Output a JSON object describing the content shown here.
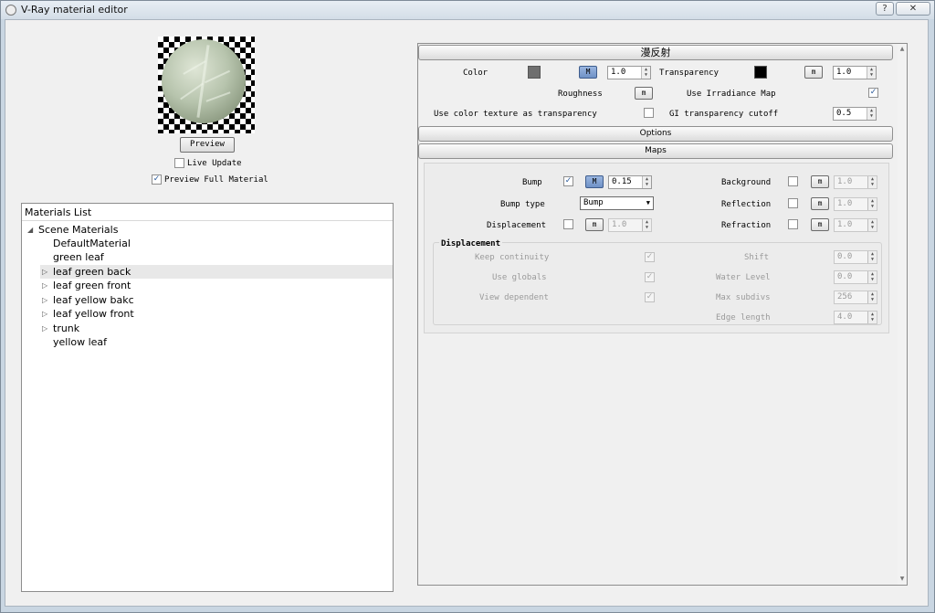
{
  "window": {
    "title": "V-Ray material editor",
    "help_label": "?",
    "close_label": "✕"
  },
  "preview": {
    "button_label": "Preview",
    "live_update_label": "Live Update",
    "live_update_checked": false,
    "preview_full_label": "Preview Full Material",
    "preview_full_checked": true
  },
  "materials": {
    "header": "Materials List",
    "root_label": "Scene Materials",
    "items": [
      {
        "label": "DefaultMaterial",
        "expandable": false,
        "selected": false
      },
      {
        "label": "green leaf",
        "expandable": false,
        "selected": false
      },
      {
        "label": "leaf green back",
        "expandable": true,
        "selected": true
      },
      {
        "label": "leaf green front",
        "expandable": true,
        "selected": false
      },
      {
        "label": "leaf yellow bakc",
        "expandable": true,
        "selected": false
      },
      {
        "label": "leaf yellow front",
        "expandable": true,
        "selected": false
      },
      {
        "label": "trunk",
        "expandable": true,
        "selected": false
      },
      {
        "label": "yellow leaf",
        "expandable": false,
        "selected": false
      }
    ]
  },
  "diffuse": {
    "header": "漫反射",
    "color_label": "Color",
    "color_swatch": "#6f6f6f",
    "color_map_label": "M",
    "color_value": "1.0",
    "transparency_label": "Transparency",
    "transparency_swatch": "#000000",
    "transparency_map_label": "m",
    "transparency_value": "1.0",
    "roughness_label": "Roughness",
    "roughness_map_label": "m",
    "irradiance_label": "Use Irradiance Map",
    "irradiance_checked": true,
    "color_texture_label": "Use color texture as transparency",
    "color_texture_checked": false,
    "gi_cutoff_label": "GI transparency cutoff",
    "gi_cutoff_value": "0.5"
  },
  "options": {
    "header": "Options"
  },
  "maps": {
    "header": "Maps",
    "bump_label": "Bump",
    "bump_checked": true,
    "bump_map_label": "M",
    "bump_value": "0.15",
    "background_label": "Background",
    "background_map_label": "m",
    "background_value": "1.0",
    "bump_type_label": "Bump type",
    "bump_type_value": "Bump",
    "reflection_label": "Reflection",
    "reflection_map_label": "m",
    "reflection_value": "1.0",
    "displacement_label": "Displacement",
    "displacement_map_label": "m",
    "displacement_value": "1.0",
    "refraction_label": "Refraction",
    "refraction_map_label": "m",
    "refraction_value": "1.0"
  },
  "displacement": {
    "group_label": "Displacement",
    "keep_continuity_label": "Keep continuity",
    "use_globals_label": "Use globals",
    "view_dependent_label": "View dependent",
    "shift_label": "Shift",
    "shift_value": "0.0",
    "water_level_label": "Water Level",
    "water_level_value": "0.0",
    "max_subdivs_label": "Max subdivs",
    "max_subdivs_value": "256",
    "edge_length_label": "Edge length",
    "edge_length_value": "4.0"
  },
  "icons": {
    "check": "✓",
    "spin_up": "▲",
    "spin_down": "▼",
    "tree_expanded": "◢",
    "tree_collapsed": "▷",
    "dropdown": "▼"
  }
}
